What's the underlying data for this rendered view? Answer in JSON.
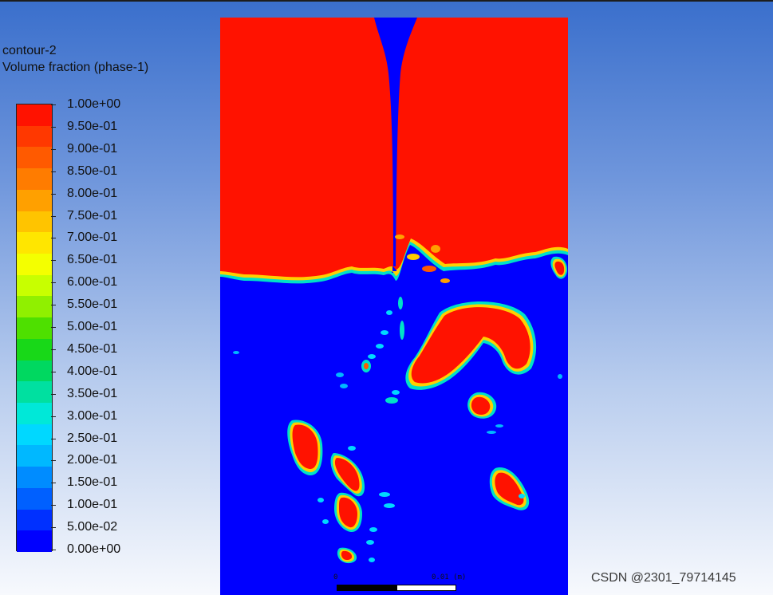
{
  "title": {
    "line1": "contour-2",
    "line2": "Volume fraction (phase-1)"
  },
  "legend": {
    "labels": [
      "1.00e+00",
      "9.50e-01",
      "9.00e-01",
      "8.50e-01",
      "8.00e-01",
      "7.50e-01",
      "7.00e-01",
      "6.50e-01",
      "6.00e-01",
      "5.50e-01",
      "5.00e-01",
      "4.50e-01",
      "4.00e-01",
      "3.50e-01",
      "3.00e-01",
      "2.50e-01",
      "2.00e-01",
      "1.50e-01",
      "1.00e-01",
      "5.00e-02",
      "0.00e+00"
    ],
    "colors": [
      "#ff1200",
      "#ff3800",
      "#ff5a00",
      "#ff7c00",
      "#ffa000",
      "#ffc400",
      "#ffe600",
      "#f4ff00",
      "#c8ff00",
      "#90f000",
      "#4ee000",
      "#18d818",
      "#00d860",
      "#00e0a0",
      "#00e8d8",
      "#00d8ff",
      "#00b8ff",
      "#008cff",
      "#0060ff",
      "#0030ff",
      "#0000ff"
    ]
  },
  "scale_bar": {
    "start_label": "0",
    "end_label": "0.01 (m)"
  },
  "watermark": "CSDN @2301_79714145"
}
